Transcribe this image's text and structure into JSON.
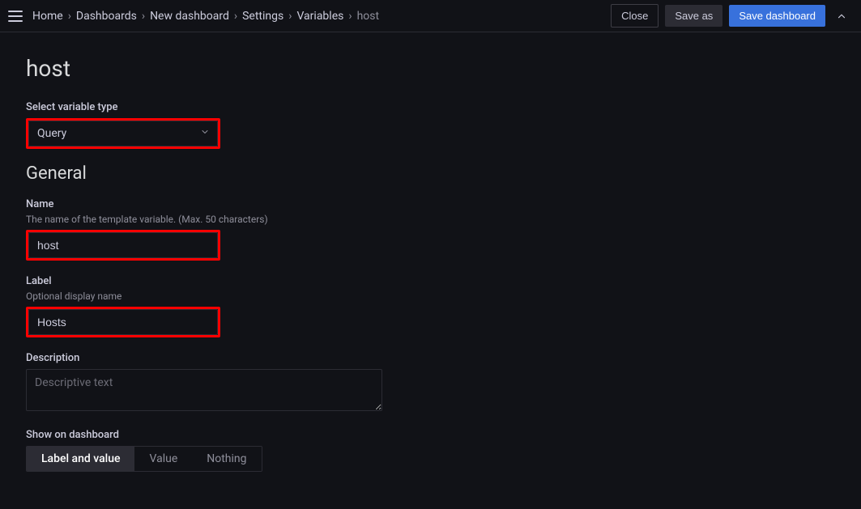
{
  "breadcrumbs": {
    "items": [
      {
        "label": "Home"
      },
      {
        "label": "Dashboards"
      },
      {
        "label": "New dashboard"
      },
      {
        "label": "Settings"
      },
      {
        "label": "Variables"
      },
      {
        "label": "host"
      }
    ],
    "sep": "›"
  },
  "actions": {
    "close": "Close",
    "save_as": "Save as",
    "save_dashboard": "Save dashboard"
  },
  "page": {
    "title": "host"
  },
  "variable_type": {
    "label": "Select variable type",
    "value": "Query"
  },
  "general": {
    "heading": "General",
    "name": {
      "label": "Name",
      "hint": "The name of the template variable. (Max. 50 characters)",
      "value": "host"
    },
    "label_field": {
      "label": "Label",
      "hint": "Optional display name",
      "value": "Hosts"
    },
    "description": {
      "label": "Description",
      "placeholder": "Descriptive text"
    },
    "show": {
      "label": "Show on dashboard",
      "options": {
        "label_value": "Label and value",
        "value": "Value",
        "nothing": "Nothing"
      }
    }
  }
}
